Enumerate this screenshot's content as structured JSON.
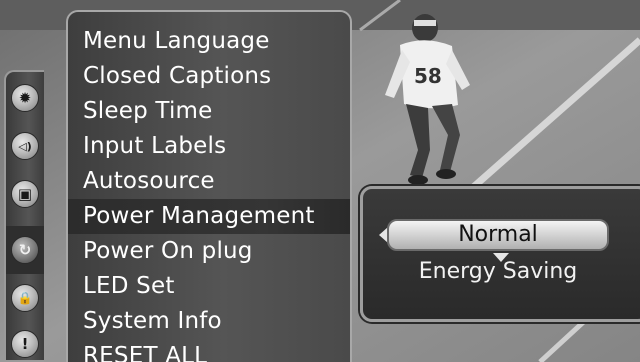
{
  "menu": {
    "items": [
      {
        "label": "Menu Language"
      },
      {
        "label": "Closed Captions"
      },
      {
        "label": "Sleep Time"
      },
      {
        "label": "Input Labels"
      },
      {
        "label": "Autosource"
      },
      {
        "label": "Power Management"
      },
      {
        "label": "Power On plug"
      },
      {
        "label": "LED Set"
      },
      {
        "label": "System Info"
      },
      {
        "label": "RESET ALL"
      }
    ],
    "selected_index": 5
  },
  "icon_strip": {
    "icons": [
      {
        "name": "picture-icon",
        "glyph": "✹"
      },
      {
        "name": "audio-icon",
        "glyph": "◁)"
      },
      {
        "name": "channel-tv-icon",
        "glyph": "▣"
      },
      {
        "name": "setup-icon",
        "glyph": "↻"
      },
      {
        "name": "lock-icon",
        "glyph": "🔒"
      },
      {
        "name": "info-alert-icon",
        "glyph": "!"
      }
    ],
    "active_index": 3
  },
  "submenu": {
    "current_value": "Normal",
    "next_option": "Energy Saving"
  },
  "background": {
    "player_number": "58"
  }
}
